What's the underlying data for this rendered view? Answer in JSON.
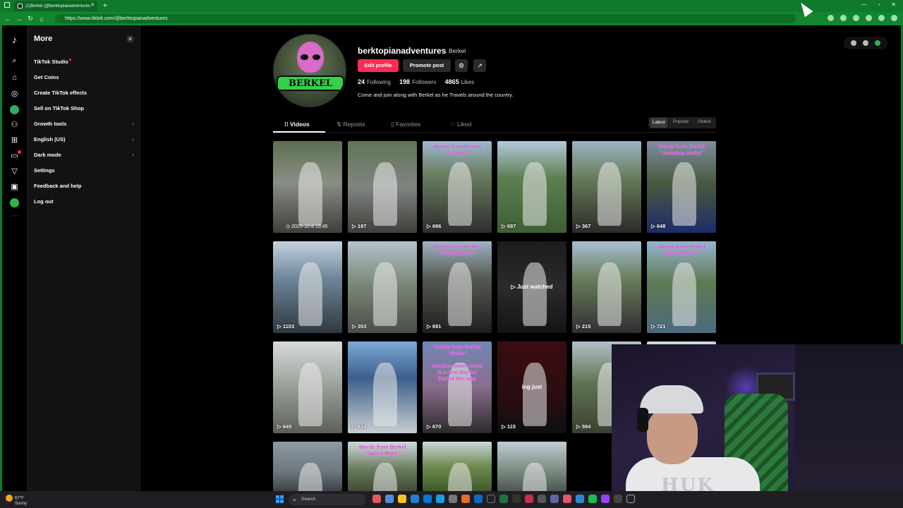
{
  "browser": {
    "tab_title": "(1)Berkel (@berktopianadventures",
    "url": "https://www.tiktok.com/@berktopianadventures"
  },
  "sidebar": {
    "title": "More",
    "items": [
      {
        "label": "TikTok Studio",
        "dot": true
      },
      {
        "label": "Get Coins"
      },
      {
        "label": "Create TikTok effects"
      },
      {
        "label": "Sell on TikTok Shop"
      },
      {
        "label": "Growth tools",
        "chevron": true
      },
      {
        "label": "English (US)",
        "chevron": true
      },
      {
        "label": "Dark mode",
        "chevron": true
      },
      {
        "label": "Settings"
      },
      {
        "label": "Feedback and help"
      },
      {
        "label": "Log out"
      }
    ]
  },
  "profile": {
    "username": "berktopianadventures",
    "display_name": "Berkel",
    "avatar_text": "BERKEL",
    "edit_label": "Edit profile",
    "promote_label": "Promote post",
    "following_count": "24",
    "following_label": "Following",
    "followers_count": "198",
    "followers_label": "Followers",
    "likes_count": "4865",
    "likes_label": "Likes",
    "bio": "Come and join along with Berkel as he Travels around the country."
  },
  "tabs": [
    "Videos",
    "Reposts",
    "Favorites",
    "Liked"
  ],
  "sort": [
    "Latest",
    "Popular",
    "Oldest"
  ],
  "videos": [
    {
      "views": "",
      "date": "2025-10-8 15:45",
      "bg": "linear-gradient(180deg,#5c7050 0%,#8a8f86 45%,#3e3f3a 100%)",
      "caption": ""
    },
    {
      "views": "197",
      "bg": "linear-gradient(180deg,#617656 0%,#7f8480 50%,#403f3b 100%)",
      "caption": ""
    },
    {
      "views": "696",
      "bg": "linear-gradient(180deg,#9db8d0 0%,#6b7f62 35%,#2d2d2c 100%)",
      "caption": "Words from Berkel\n\"Sinking\""
    },
    {
      "views": "697",
      "bg": "linear-gradient(180deg,#b4c9de 0%,#5e7f50 40%,#3d5e32 100%)",
      "caption": ""
    },
    {
      "views": "367",
      "bg": "linear-gradient(180deg,#9db4c6 0%,#677c5a 40%,#2b2a28 100%)",
      "caption": ""
    },
    {
      "views": "648",
      "bg": "linear-gradient(180deg,#7d8fa2 0%,#4a5a3f 45%,#1c2c68 100%)",
      "caption": "Words from Berkel\n\"Jumping Jacks\""
    },
    {
      "views": "1103",
      "bg": "linear-gradient(180deg,#c3d2de 0%,#6f879a 40%,#2f3740 100%)",
      "caption": ""
    },
    {
      "views": "353",
      "bg": "linear-gradient(180deg,#b3c2cf 0%,#7d8a78 45%,#4a4e49 100%)",
      "caption": ""
    },
    {
      "views": "691",
      "bg": "linear-gradient(180deg,#9fb3c4 0%,#555a52 40%,#1f1f1e 100%)",
      "caption": "Words from Berkel\n\"Sinking Line\""
    },
    {
      "views": "",
      "bg": "linear-gradient(180deg,#1b1b1e 0%,#2c2a2b 50%,#141414 100%)",
      "caption": "",
      "overlay": "▷ Just watched"
    },
    {
      "views": "215",
      "bg": "linear-gradient(180deg,#a9bfd3 0%,#687f5c 40%,#2f2f30 100%)",
      "caption": ""
    },
    {
      "views": "721",
      "bg": "linear-gradient(180deg,#95b3cf 0%,#5e7a52 45%,#4b6a80 100%)",
      "caption": "Words from Berkel\n\"Broken Pole\""
    },
    {
      "views": "645",
      "bg": "linear-gradient(180deg,#d7dadb 0%,#9ea59e 45%,#5d605a 100%)",
      "caption": ""
    },
    {
      "views": "614",
      "bg": "linear-gradient(180deg,#7ea9d6 0%,#3b5f8c 40%,#c9cdd2 100%)",
      "caption": ""
    },
    {
      "views": "670",
      "bg": "linear-gradient(180deg,#6f88b5 0%,#8a6d8c 50%,#2b2a2a 100%)",
      "caption": "Words from Berkel\n\"Sleep\"\n\nAnother water drum\nis a new day for\nBerkel this way"
    },
    {
      "views": "115",
      "bg": "linear-gradient(180deg,#3a0c12 0%,#2a0d10 60%,#0f0f0f 100%)",
      "caption": "",
      "overlay": "ing just"
    },
    {
      "views": "594",
      "bg": "linear-gradient(180deg,#b2c0c8 0%,#5f7453 45%,#3a4030 100%)",
      "caption": ""
    },
    {
      "views": "",
      "bg": "linear-gradient(180deg,#c9d8e2 0%,#9fb0bd 60%,#6c7c87 100%)",
      "caption": ""
    },
    {
      "views": "",
      "bg": "linear-gradient(180deg,#8f9aa4 0%,#6d7780 60%,#3c4348 100%)",
      "caption": ""
    },
    {
      "views": "",
      "bg": "linear-gradient(180deg,#cfd8de 0%,#6b7d5f 55%,#3f4a36 100%)",
      "caption": "Words from Berkel\n\"Sign a Rock\""
    },
    {
      "views": "",
      "bg": "linear-gradient(180deg,#cad4dd 0%,#6e8b4f 50%,#3f5a2c 100%)",
      "caption": ""
    },
    {
      "views": "",
      "bg": "linear-gradient(180deg,#c0ccd4 0%,#7f8f86 55%,#4b5750 100%)",
      "caption": ""
    }
  ],
  "taskbar": {
    "temp": "67°F",
    "condition": "Sunny",
    "search_placeholder": "Search"
  }
}
